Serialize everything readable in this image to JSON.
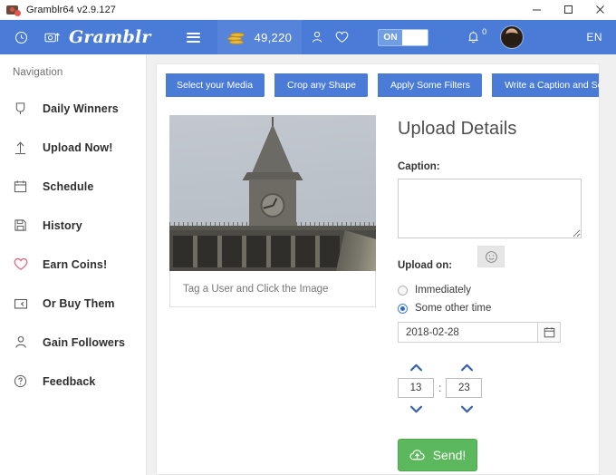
{
  "window": {
    "title": "Gramblr64 v2.9.127",
    "app_icon": "camera-upload-icon",
    "minimize_label": "Minimize",
    "maximize_label": "Maximize",
    "close_label": "Close"
  },
  "header": {
    "history_icon": "clock-icon",
    "upload_icon": "camera-upload-icon",
    "logo": "Gramblr",
    "menu_icon": "hamburger-menu-icon",
    "coins_icon": "coin-stack-icon",
    "coins_count": "49,220",
    "person_icon": "person-icon",
    "heart_icon": "heart-icon",
    "toggle_label": "ON",
    "bell_icon": "bell-icon",
    "bell_badge": "0",
    "avatar_label": "User avatar",
    "language": "EN",
    "accent_color": "#4a7bd6"
  },
  "sidebar": {
    "title": "Navigation",
    "items": [
      {
        "label": "Daily Winners",
        "icon": "trophy-icon"
      },
      {
        "label": "Upload Now!",
        "icon": "upload-arrow-icon"
      },
      {
        "label": "Schedule",
        "icon": "calendar-icon"
      },
      {
        "label": "History",
        "icon": "save-disk-icon"
      },
      {
        "label": "Earn Coins!",
        "icon": "heart-icon"
      },
      {
        "label": "Or Buy Them",
        "icon": "card-icon"
      },
      {
        "label": "Gain Followers",
        "icon": "person-icon"
      },
      {
        "label": "Feedback",
        "icon": "question-circle-icon"
      }
    ]
  },
  "steps": [
    {
      "label": "Select your Media"
    },
    {
      "label": "Crop any Shape"
    },
    {
      "label": "Apply Some Filters"
    },
    {
      "label": "Write a Caption and Send"
    }
  ],
  "preview": {
    "alt": "Clock tower photo",
    "tag_hint": "Tag a User and Click the Image"
  },
  "details": {
    "title": "Upload Details",
    "caption_label": "Caption:",
    "caption_value": "",
    "caption_placeholder": "",
    "emoji_icon": "smiley-face-icon",
    "upload_on_label": "Upload on:",
    "radio_immediately": "Immediately",
    "radio_other_time": "Some other time",
    "selected_option": "Some other time",
    "date_value": "2018-02-28",
    "calendar_icon": "calendar-icon",
    "hour_value": "13",
    "minute_value": "23",
    "time_separator": ":",
    "hour_up_icon": "chevron-up-icon",
    "hour_down_icon": "chevron-down-icon",
    "minute_up_icon": "chevron-up-icon",
    "minute_down_icon": "chevron-down-icon",
    "send_label": "Send!",
    "send_icon": "cloud-upload-icon",
    "send_color": "#5cb85c"
  }
}
